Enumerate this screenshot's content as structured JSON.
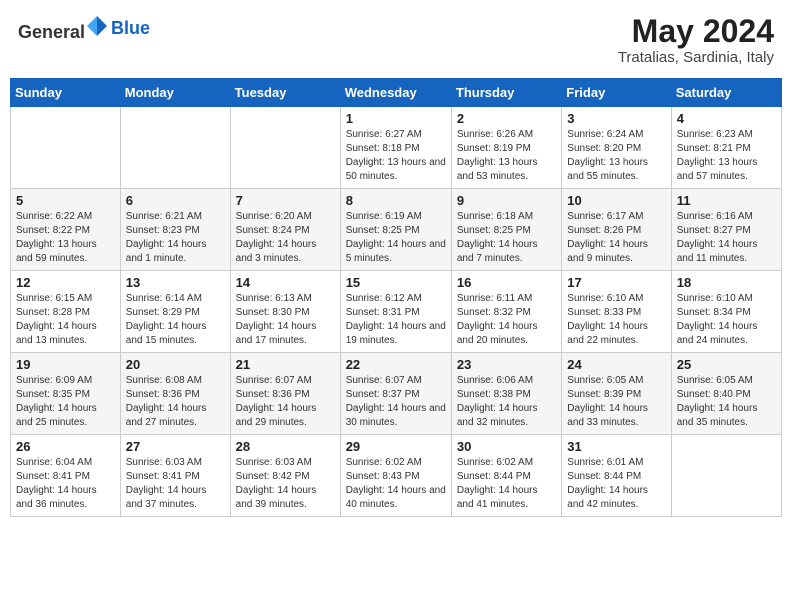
{
  "header": {
    "logo_general": "General",
    "logo_blue": "Blue",
    "month_year": "May 2024",
    "location": "Tratalias, Sardinia, Italy"
  },
  "days_of_week": [
    "Sunday",
    "Monday",
    "Tuesday",
    "Wednesday",
    "Thursday",
    "Friday",
    "Saturday"
  ],
  "weeks": [
    [
      {
        "day": "",
        "sunrise": "",
        "sunset": "",
        "daylight": ""
      },
      {
        "day": "",
        "sunrise": "",
        "sunset": "",
        "daylight": ""
      },
      {
        "day": "",
        "sunrise": "",
        "sunset": "",
        "daylight": ""
      },
      {
        "day": "1",
        "sunrise": "Sunrise: 6:27 AM",
        "sunset": "Sunset: 8:18 PM",
        "daylight": "Daylight: 13 hours and 50 minutes."
      },
      {
        "day": "2",
        "sunrise": "Sunrise: 6:26 AM",
        "sunset": "Sunset: 8:19 PM",
        "daylight": "Daylight: 13 hours and 53 minutes."
      },
      {
        "day": "3",
        "sunrise": "Sunrise: 6:24 AM",
        "sunset": "Sunset: 8:20 PM",
        "daylight": "Daylight: 13 hours and 55 minutes."
      },
      {
        "day": "4",
        "sunrise": "Sunrise: 6:23 AM",
        "sunset": "Sunset: 8:21 PM",
        "daylight": "Daylight: 13 hours and 57 minutes."
      }
    ],
    [
      {
        "day": "5",
        "sunrise": "Sunrise: 6:22 AM",
        "sunset": "Sunset: 8:22 PM",
        "daylight": "Daylight: 13 hours and 59 minutes."
      },
      {
        "day": "6",
        "sunrise": "Sunrise: 6:21 AM",
        "sunset": "Sunset: 8:23 PM",
        "daylight": "Daylight: 14 hours and 1 minute."
      },
      {
        "day": "7",
        "sunrise": "Sunrise: 6:20 AM",
        "sunset": "Sunset: 8:24 PM",
        "daylight": "Daylight: 14 hours and 3 minutes."
      },
      {
        "day": "8",
        "sunrise": "Sunrise: 6:19 AM",
        "sunset": "Sunset: 8:25 PM",
        "daylight": "Daylight: 14 hours and 5 minutes."
      },
      {
        "day": "9",
        "sunrise": "Sunrise: 6:18 AM",
        "sunset": "Sunset: 8:25 PM",
        "daylight": "Daylight: 14 hours and 7 minutes."
      },
      {
        "day": "10",
        "sunrise": "Sunrise: 6:17 AM",
        "sunset": "Sunset: 8:26 PM",
        "daylight": "Daylight: 14 hours and 9 minutes."
      },
      {
        "day": "11",
        "sunrise": "Sunrise: 6:16 AM",
        "sunset": "Sunset: 8:27 PM",
        "daylight": "Daylight: 14 hours and 11 minutes."
      }
    ],
    [
      {
        "day": "12",
        "sunrise": "Sunrise: 6:15 AM",
        "sunset": "Sunset: 8:28 PM",
        "daylight": "Daylight: 14 hours and 13 minutes."
      },
      {
        "day": "13",
        "sunrise": "Sunrise: 6:14 AM",
        "sunset": "Sunset: 8:29 PM",
        "daylight": "Daylight: 14 hours and 15 minutes."
      },
      {
        "day": "14",
        "sunrise": "Sunrise: 6:13 AM",
        "sunset": "Sunset: 8:30 PM",
        "daylight": "Daylight: 14 hours and 17 minutes."
      },
      {
        "day": "15",
        "sunrise": "Sunrise: 6:12 AM",
        "sunset": "Sunset: 8:31 PM",
        "daylight": "Daylight: 14 hours and 19 minutes."
      },
      {
        "day": "16",
        "sunrise": "Sunrise: 6:11 AM",
        "sunset": "Sunset: 8:32 PM",
        "daylight": "Daylight: 14 hours and 20 minutes."
      },
      {
        "day": "17",
        "sunrise": "Sunrise: 6:10 AM",
        "sunset": "Sunset: 8:33 PM",
        "daylight": "Daylight: 14 hours and 22 minutes."
      },
      {
        "day": "18",
        "sunrise": "Sunrise: 6:10 AM",
        "sunset": "Sunset: 8:34 PM",
        "daylight": "Daylight: 14 hours and 24 minutes."
      }
    ],
    [
      {
        "day": "19",
        "sunrise": "Sunrise: 6:09 AM",
        "sunset": "Sunset: 8:35 PM",
        "daylight": "Daylight: 14 hours and 25 minutes."
      },
      {
        "day": "20",
        "sunrise": "Sunrise: 6:08 AM",
        "sunset": "Sunset: 8:36 PM",
        "daylight": "Daylight: 14 hours and 27 minutes."
      },
      {
        "day": "21",
        "sunrise": "Sunrise: 6:07 AM",
        "sunset": "Sunset: 8:36 PM",
        "daylight": "Daylight: 14 hours and 29 minutes."
      },
      {
        "day": "22",
        "sunrise": "Sunrise: 6:07 AM",
        "sunset": "Sunset: 8:37 PM",
        "daylight": "Daylight: 14 hours and 30 minutes."
      },
      {
        "day": "23",
        "sunrise": "Sunrise: 6:06 AM",
        "sunset": "Sunset: 8:38 PM",
        "daylight": "Daylight: 14 hours and 32 minutes."
      },
      {
        "day": "24",
        "sunrise": "Sunrise: 6:05 AM",
        "sunset": "Sunset: 8:39 PM",
        "daylight": "Daylight: 14 hours and 33 minutes."
      },
      {
        "day": "25",
        "sunrise": "Sunrise: 6:05 AM",
        "sunset": "Sunset: 8:40 PM",
        "daylight": "Daylight: 14 hours and 35 minutes."
      }
    ],
    [
      {
        "day": "26",
        "sunrise": "Sunrise: 6:04 AM",
        "sunset": "Sunset: 8:41 PM",
        "daylight": "Daylight: 14 hours and 36 minutes."
      },
      {
        "day": "27",
        "sunrise": "Sunrise: 6:03 AM",
        "sunset": "Sunset: 8:41 PM",
        "daylight": "Daylight: 14 hours and 37 minutes."
      },
      {
        "day": "28",
        "sunrise": "Sunrise: 6:03 AM",
        "sunset": "Sunset: 8:42 PM",
        "daylight": "Daylight: 14 hours and 39 minutes."
      },
      {
        "day": "29",
        "sunrise": "Sunrise: 6:02 AM",
        "sunset": "Sunset: 8:43 PM",
        "daylight": "Daylight: 14 hours and 40 minutes."
      },
      {
        "day": "30",
        "sunrise": "Sunrise: 6:02 AM",
        "sunset": "Sunset: 8:44 PM",
        "daylight": "Daylight: 14 hours and 41 minutes."
      },
      {
        "day": "31",
        "sunrise": "Sunrise: 6:01 AM",
        "sunset": "Sunset: 8:44 PM",
        "daylight": "Daylight: 14 hours and 42 minutes."
      },
      {
        "day": "",
        "sunrise": "",
        "sunset": "",
        "daylight": ""
      }
    ]
  ]
}
